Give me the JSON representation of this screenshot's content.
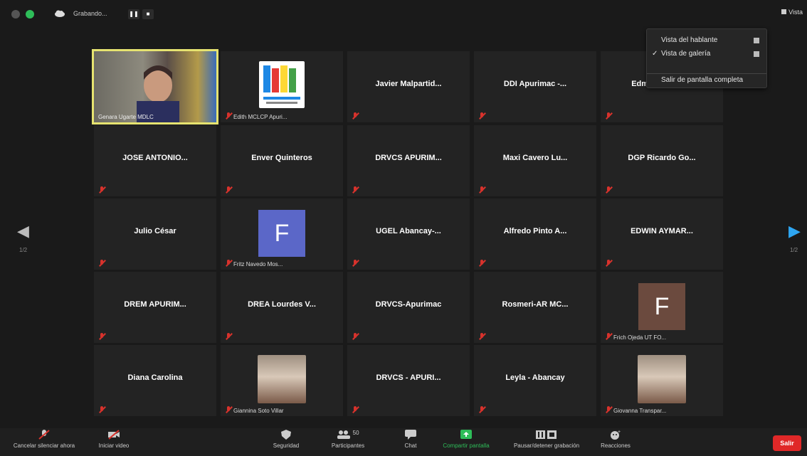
{
  "topbar": {
    "recording_label": "Grabando...",
    "pause_label": "❚❚",
    "stop_label": "■",
    "view_label": "Vista"
  },
  "menu": {
    "items": [
      {
        "label": "Vista del hablante",
        "checked": false
      },
      {
        "label": "Vista de galería",
        "checked": true
      }
    ],
    "exit_fullscreen": "Salir de pantalla completa",
    "check_mark": "✓"
  },
  "participants": [
    {
      "name": "Genara Ugarte MDLC",
      "kind": "video",
      "active": true
    },
    {
      "name": "Edith MCLCP Apuri...",
      "kind": "logo"
    },
    {
      "name": "Javier  Malpartid...",
      "kind": "name"
    },
    {
      "name": "DDI Apurimac -...",
      "kind": "name"
    },
    {
      "name": "Edmundo López",
      "kind": "name"
    },
    {
      "name": "JOSE  ANTONIO...",
      "kind": "name"
    },
    {
      "name": "Enver Quinteros",
      "kind": "name"
    },
    {
      "name": "DRVCS  APURIM...",
      "kind": "name"
    },
    {
      "name": "Maxi Cavero Lu...",
      "kind": "name"
    },
    {
      "name": "DGP Ricardo Go...",
      "kind": "name"
    },
    {
      "name": "Julio César",
      "kind": "name"
    },
    {
      "name": "Fritz Navedo Mos...",
      "kind": "avatar",
      "initial": "F",
      "color": "#5b67c8"
    },
    {
      "name": "UGEL Abancay-...",
      "kind": "name"
    },
    {
      "name": "Alfredo Pinto A...",
      "kind": "name"
    },
    {
      "name": "EDWIN  AYMAR...",
      "kind": "name"
    },
    {
      "name": "DREM  APURIM...",
      "kind": "name"
    },
    {
      "name": "DREA Lourdes V...",
      "kind": "name"
    },
    {
      "name": "DRVCS-Apurimac",
      "kind": "name"
    },
    {
      "name": "Rosmeri-AR MC...",
      "kind": "name"
    },
    {
      "name": "Frich Ojeda UT FO...",
      "kind": "avatar",
      "initial": "F",
      "color": "#6b4a3e"
    },
    {
      "name": "Diana Carolina",
      "kind": "name"
    },
    {
      "name": "Giannina Soto Villar",
      "kind": "photo"
    },
    {
      "name": "DRVCS - APURI...",
      "kind": "name"
    },
    {
      "name": "Leyla - Abancay",
      "kind": "name"
    },
    {
      "name": "Giovanna Transpar...",
      "kind": "photo"
    }
  ],
  "pagination": {
    "left": "1/2",
    "right": "1/2"
  },
  "toolbar": {
    "unmute": "Cancelar silenciar ahora",
    "start_video": "Iniciar video",
    "security": "Seguridad",
    "participants": "Participantes",
    "participants_count": "50",
    "chat": "Chat",
    "share": "Compartir pantalla",
    "record": "Pausar/detener grabación",
    "reactions": "Reacciones",
    "leave": "Salir"
  },
  "colors": {
    "active_border": "#e6e370",
    "share_green": "#2ebd59",
    "leave_red": "#e02828",
    "muted_red": "#d8322c"
  }
}
